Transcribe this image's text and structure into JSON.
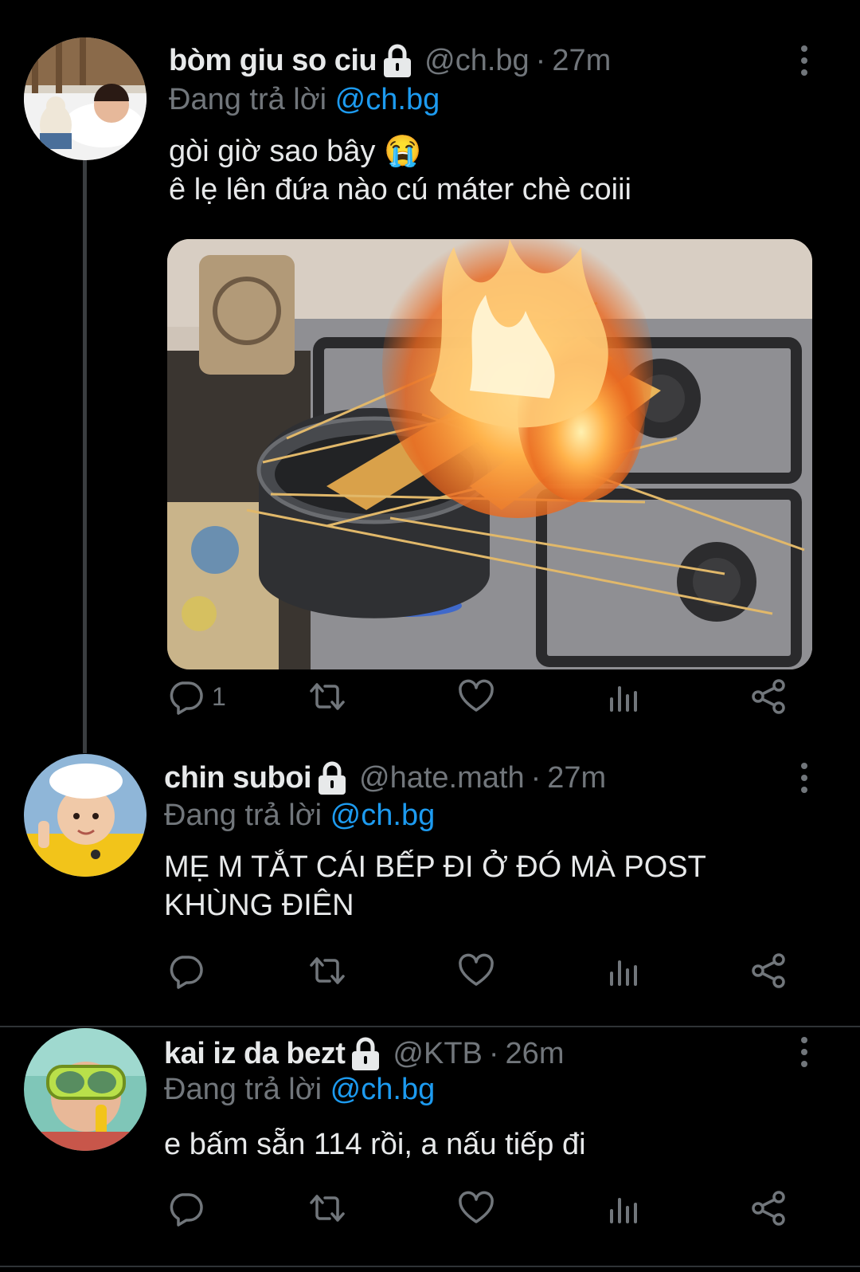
{
  "tweets": [
    {
      "name": "bòm giu so ciu",
      "handle": "@ch.bg",
      "separator": "·",
      "time": "27m",
      "replying_prefix": "Đang trả lời",
      "replying_to": "@ch.bg",
      "text": "gòi giờ sao bây 😭\nê lẹ lên đứa nào cú máter chè coiii",
      "reply_count": "1"
    },
    {
      "name": "chin suboi",
      "handle": "@hate.math",
      "separator": "·",
      "time": "27m",
      "replying_prefix": "Đang trả lời",
      "replying_to": "@ch.bg",
      "text": "MẸ M TẮT CÁI BẾP ĐI Ở ĐÓ MÀ POST\nKHÙNG ĐIÊN",
      "reply_count": ""
    },
    {
      "name": "kai iz da bezt",
      "handle": "@KTB",
      "separator": "·",
      "time": "26m",
      "replying_prefix": "Đang trả lời",
      "replying_to": "@ch.bg",
      "text": "e bấm sẵn 114 rồi, a nấu tiếp đi",
      "reply_count": ""
    }
  ],
  "icons": {
    "lock": "lock-icon",
    "more": "more-vertical-icon",
    "reply": "reply-icon",
    "retweet": "retweet-icon",
    "like": "heart-icon",
    "views": "analytics-icon",
    "share": "share-icon"
  },
  "colors": {
    "background": "#000000",
    "text": "#e7e9ea",
    "muted": "#71767b",
    "mention": "#1d9bf0"
  }
}
